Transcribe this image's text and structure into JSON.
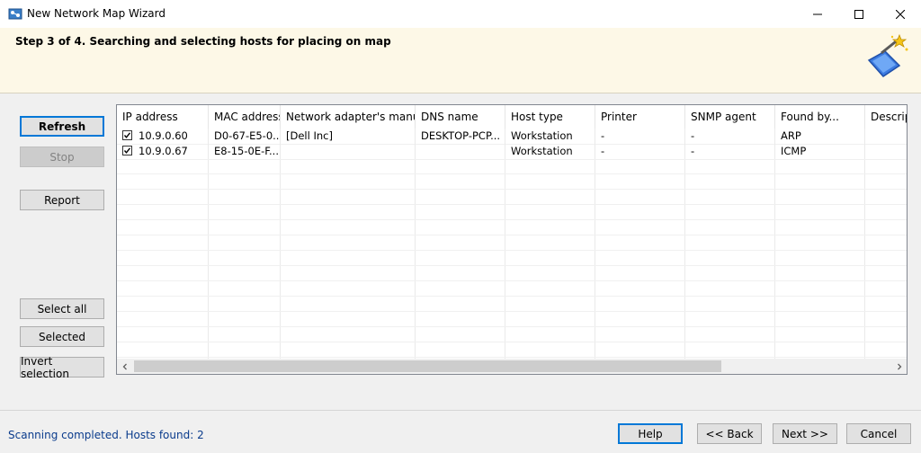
{
  "window": {
    "title": "New Network Map Wizard",
    "icon": "network-map-icon"
  },
  "header": {
    "step_title": "Step 3 of 4. Searching and selecting hosts for placing on map",
    "icon": "wizard-wand-icon"
  },
  "side_buttons": {
    "refresh": "Refresh",
    "stop": "Stop",
    "report": "Report",
    "select_all": "Select all",
    "selected": "Selected",
    "invert_selection": "Invert selection"
  },
  "table": {
    "columns": [
      "IP address",
      "MAC address",
      "Network adapter's manufa...",
      "DNS name",
      "Host type",
      "Printer",
      "SNMP agent",
      "Found by...",
      "Descript"
    ],
    "rows": [
      {
        "checked": true,
        "cells": [
          "10.9.0.60",
          "D0-67-E5-0...",
          "[Dell Inc]",
          "DESKTOP-PCP...",
          "Workstation",
          "-",
          "-",
          "ARP",
          ""
        ]
      },
      {
        "checked": true,
        "cells": [
          "10.9.0.67",
          "E8-15-0E-F...",
          "",
          "",
          "Workstation",
          "-",
          "-",
          "ICMP",
          ""
        ]
      }
    ]
  },
  "status": "Scanning completed. Hosts found: 2",
  "footer_buttons": {
    "help": "Help",
    "back": "<< Back",
    "next": "Next >>",
    "cancel": "Cancel"
  },
  "colors": {
    "header_bg": "#fdf8e7",
    "status_text": "#0a3b8c",
    "focus_border": "#0078d7"
  }
}
